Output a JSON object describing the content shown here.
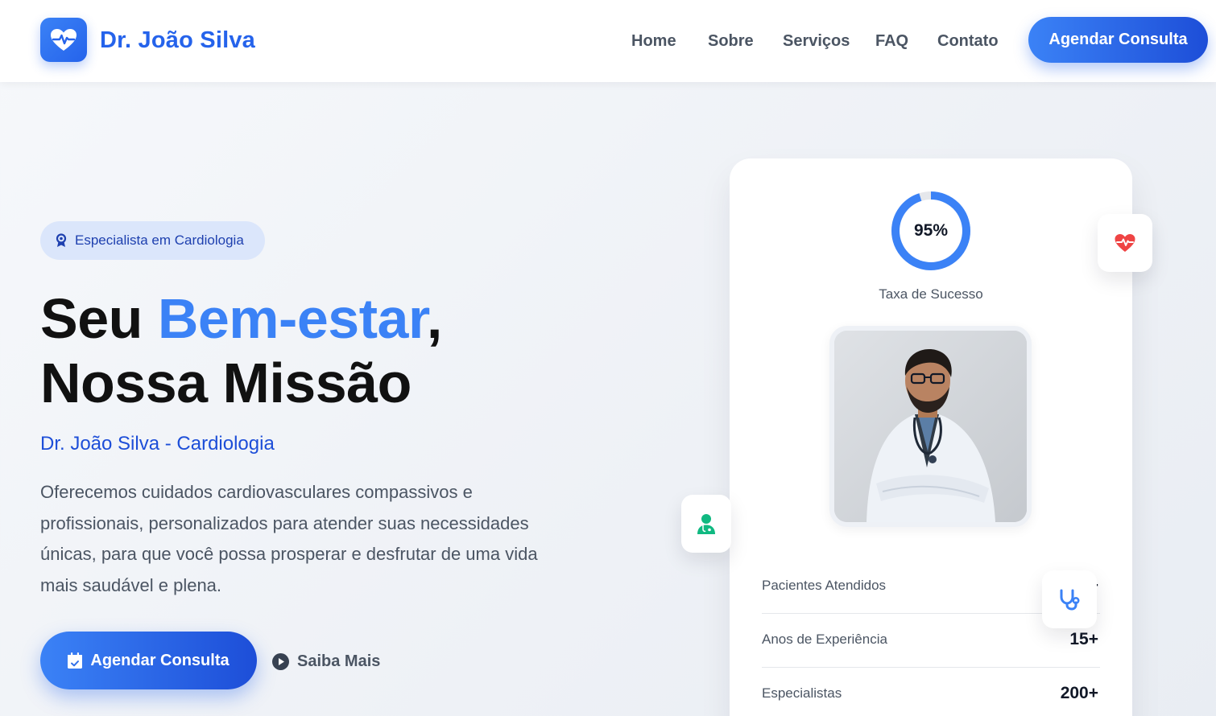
{
  "header": {
    "brand": "Dr. João Silva",
    "nav": [
      "Home",
      "Sobre",
      "Serviços",
      "FAQ",
      "Contato"
    ],
    "cta": "Agendar Consulta"
  },
  "hero": {
    "badge": "Especialista em Cardiologia",
    "title_part1": "Seu ",
    "title_accent": "Bem-estar",
    "title_part2": ",",
    "title_line2": "Nossa Missão",
    "subtitle": "Dr. João Silva - Cardiologia",
    "description": "Oferecemos cuidados cardiovasculares compassivos e profissionais, personalizados para atender suas necessidades únicas, para que você possa prosperar e desfrutar de uma vida mais saudável e plena.",
    "primary_cta": "Agendar Consulta",
    "secondary_cta": "Saiba Mais"
  },
  "card": {
    "success_rate_label": "95%",
    "success_rate": 0.95,
    "success_caption": "Taxa de Sucesso",
    "stats": [
      {
        "label": "Pacientes Atendidos",
        "value": "+"
      },
      {
        "label": "Anos de Experiência",
        "value": "15+"
      },
      {
        "label": "Especialistas",
        "value": "200+"
      }
    ]
  },
  "colors": {
    "primary": "#3b82f6",
    "primary_dark": "#1d4ed8",
    "heart_red": "#ef4444",
    "doctor_green": "#10b981"
  },
  "icons": [
    "heart-pulse-icon",
    "award-icon",
    "calendar-check-icon",
    "play-circle-icon",
    "heart-icon",
    "user-doctor-icon",
    "stethoscope-icon"
  ]
}
